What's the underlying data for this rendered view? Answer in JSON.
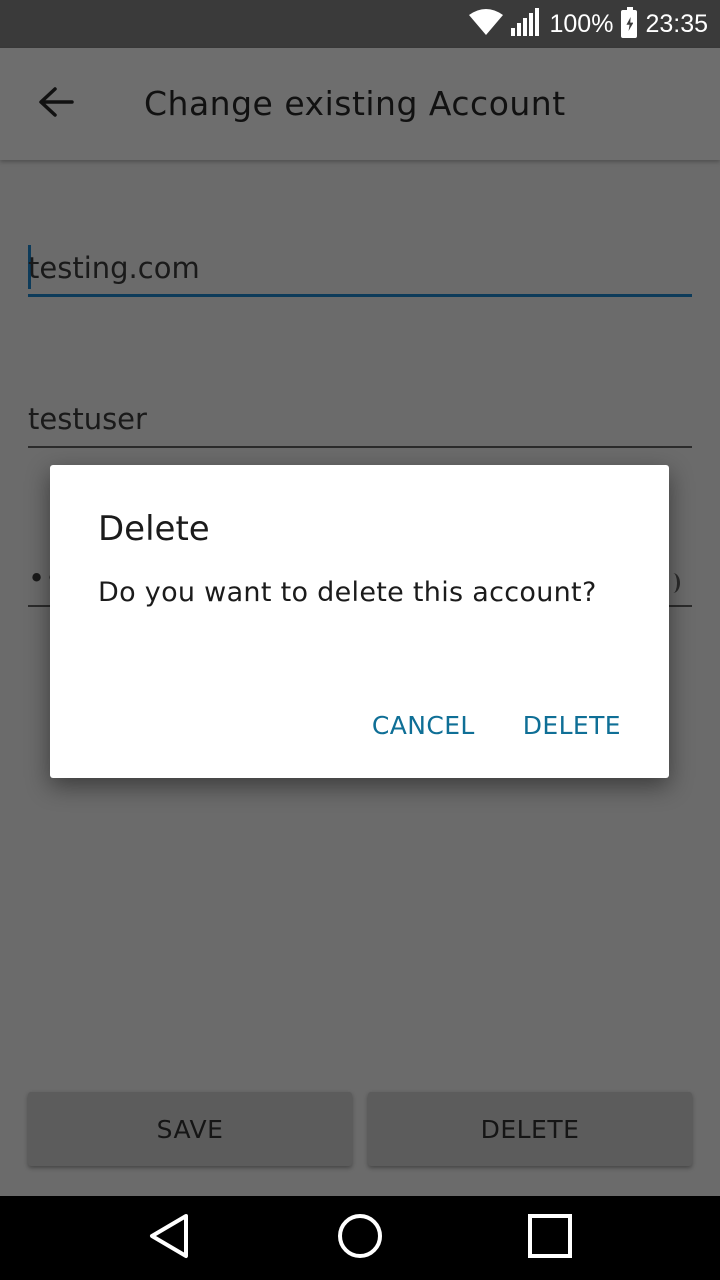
{
  "status_bar": {
    "battery_percent": "100%",
    "time": "23:35",
    "icons": [
      "wifi-icon",
      "signal-icon",
      "battery-charging-icon"
    ]
  },
  "app_bar": {
    "title": "Change existing Account",
    "back_icon": "arrow-left-icon"
  },
  "form": {
    "server": "testing.com",
    "username": "testuser",
    "password_masked": "••"
  },
  "buttons": {
    "save": "SAVE",
    "delete": "DELETE"
  },
  "dialog": {
    "title": "Delete",
    "message": "Do you want to delete this account?",
    "cancel": "CANCEL",
    "confirm": "DELETE"
  },
  "nav_bar": {
    "icons": [
      "nav-back-icon",
      "nav-home-icon",
      "nav-recents-icon"
    ]
  },
  "colors": {
    "accent": "#0f6f96",
    "focus_underline": "#0d3b5a",
    "scrim_background": "#6b6b6b",
    "dialog_background": "#ffffff"
  }
}
